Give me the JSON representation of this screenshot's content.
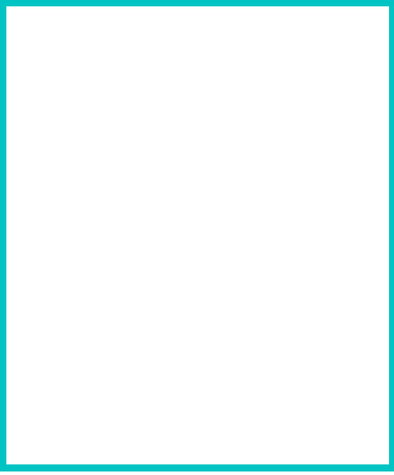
{
  "frame": {
    "border_color": "#00c4c4",
    "background_color": "#ffffff"
  }
}
